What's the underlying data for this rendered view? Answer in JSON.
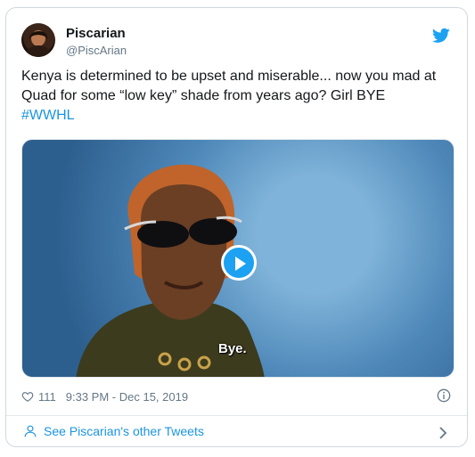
{
  "author": {
    "name": "Piscarian",
    "handle": "@PiscArian"
  },
  "tweet": {
    "text": "Kenya is determined to be upset and miserable... now you mad at Quad for some “low key” shade from years ago?  Girl BYE",
    "hashtag": "#WWHL"
  },
  "media": {
    "caption": "Bye."
  },
  "meta": {
    "likes": "111",
    "timestamp": "9:33 PM - Dec 15, 2019"
  },
  "footer": {
    "link": "See Piscarian's other Tweets"
  },
  "colors": {
    "accent": "#1da1f2",
    "link": "#1b95e0",
    "muted": "#657786",
    "border": "#cfd9de"
  },
  "icons": [
    "twitter-bird-icon",
    "heart-icon",
    "info-icon",
    "person-icon",
    "chevron-right-icon",
    "play-icon"
  ]
}
